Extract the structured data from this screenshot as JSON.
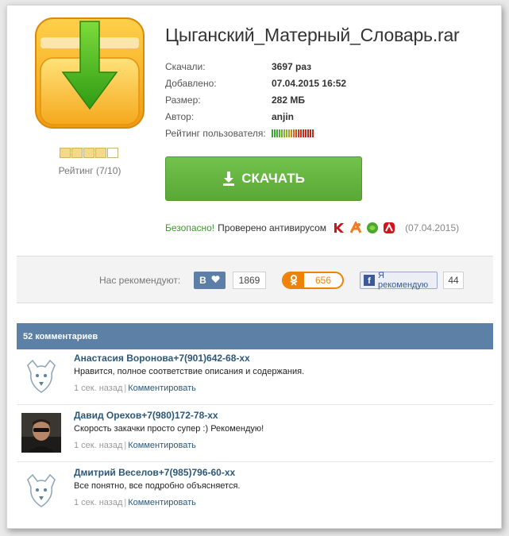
{
  "file": {
    "title": "Цыганский_Матерный_Словарь.rar",
    "rating_label": "Рейтинг (7/10)",
    "rating_score": 7,
    "rating_max": 10,
    "star_count": 5,
    "stars_filled": 4,
    "icon": "folder-download-icon"
  },
  "meta": {
    "downloads_label": "Скачали:",
    "downloads_value": "3697 раз",
    "added_label": "Добавлено:",
    "added_value": "07.04.2015 16:52",
    "size_label": "Размер:",
    "size_value": "282 МБ",
    "author_label": "Автор:",
    "author_value": "anjin",
    "user_rating_label": "Рейтинг пользователя:"
  },
  "download": {
    "label": "СКАЧАТЬ",
    "icon": "download-arrow-icon"
  },
  "safety": {
    "safe_label": "Безопасно!",
    "checked_text": "Проверено антивирусом",
    "date": "(07.04.2015)",
    "antivirus_icons": [
      "kaspersky-icon",
      "avast-icon",
      "drweb-icon",
      "avira-icon"
    ]
  },
  "recommend": {
    "label": "Нас рекомендуют:",
    "vk_label": "В",
    "vk_count": "1869",
    "ok_count": "656",
    "fb_label": "Я рекомендую",
    "fb_count": "44"
  },
  "comments": {
    "header": "52 комментариев",
    "items": [
      {
        "author": "Анастасия  Воронова+7(901)642-68-хх",
        "text": "Нравится, полное соответствие описания и содержания.",
        "time": "1 сек. назад",
        "reply": "Комментировать"
      },
      {
        "author": "Давид  Орехов+7(980)172-78-хх",
        "text": "Скорость закачки просто супер :) Рекомендую!",
        "time": "1 сек. назад",
        "reply": "Комментировать"
      },
      {
        "author": "Дмитрий  Веселов+7(985)796-60-хх",
        "text": "Все понятно, все подробно объясняется.",
        "time": "1 сек. назад",
        "reply": "Комментировать"
      }
    ]
  },
  "colors": {
    "accent_green": "#5aa835",
    "header_blue": "#5d80a6",
    "link_blue": "#2b587a",
    "ok_orange": "#ee8208"
  }
}
